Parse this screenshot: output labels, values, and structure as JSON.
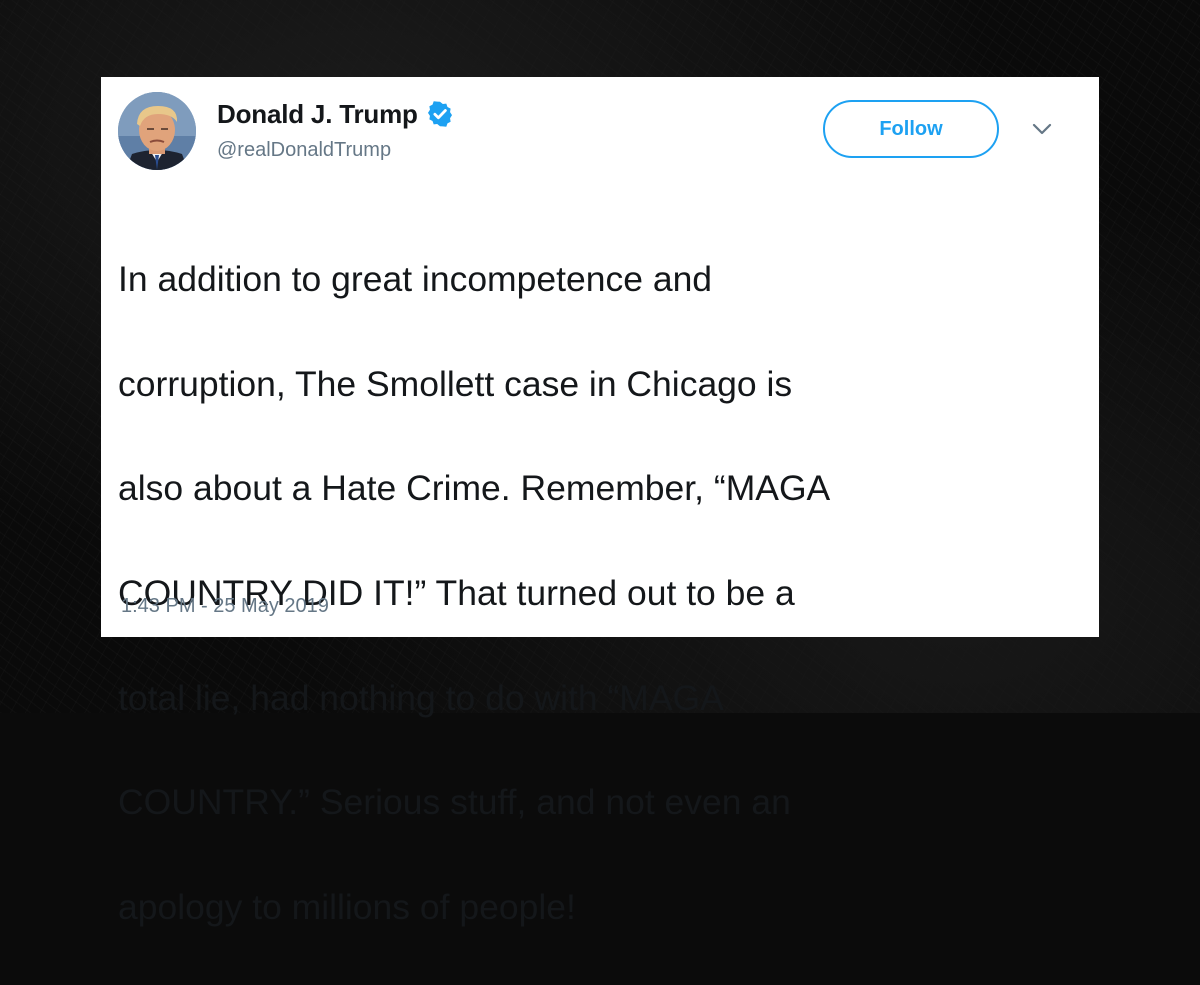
{
  "tweet": {
    "author": {
      "name": "Donald J. Trump",
      "handle": "@realDonaldTrump",
      "verified": true,
      "avatar_icon": "profile-photo"
    },
    "follow_label": "Follow",
    "menu_icon": "chevron-down-icon",
    "text_lines": [
      "In addition to great incompetence and",
      "corruption, The Smollett case in Chicago is",
      "also about a Hate Crime. Remember, “MAGA",
      "COUNTRY DID IT!” That turned out to be a",
      "total lie, had nothing to do with “MAGA",
      "COUNTRY.” Serious stuff, and not even an",
      "apology to millions of people!"
    ],
    "timestamp": "1:43 PM - 25 May 2019"
  },
  "colors": {
    "accent": "#1da1f2",
    "text": "#14171a",
    "secondary_text": "#657786",
    "background": "#0b0b0b",
    "card": "#ffffff"
  }
}
